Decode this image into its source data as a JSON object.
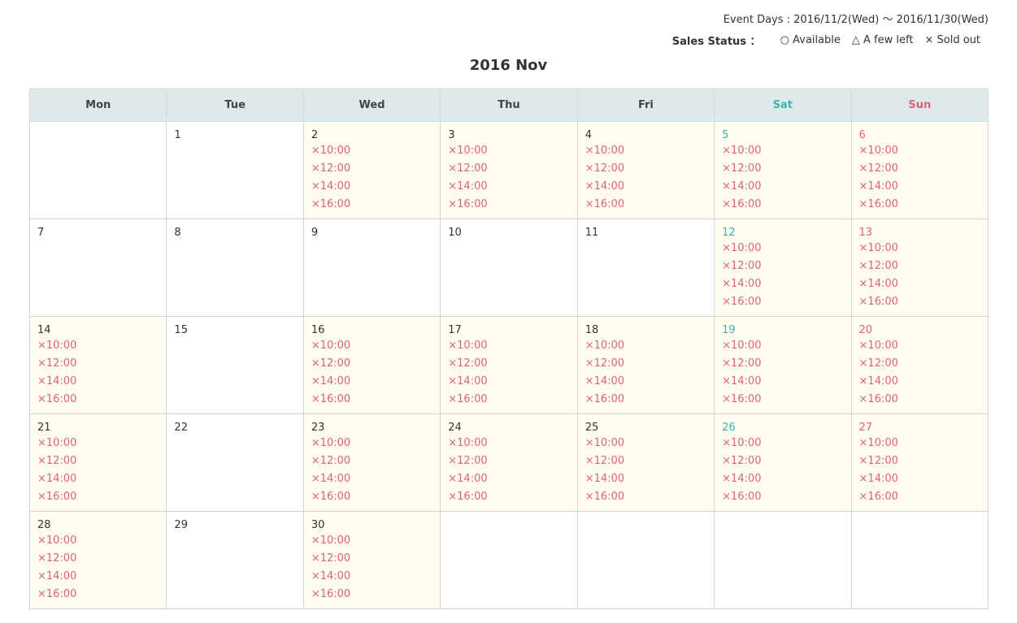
{
  "header": {
    "event_days": "Event Days : 2016/11/2(Wed) ～ 2016/11/30(Wed)",
    "sales_status_label": "Sales Status ：",
    "legend": [
      {
        "symbol": "○",
        "label": "Available",
        "icon": "circle-icon"
      },
      {
        "symbol": "△",
        "label": "A few left",
        "icon": "triangle-icon"
      },
      {
        "symbol": "×",
        "label": "Sold out",
        "icon": "cross-icon"
      }
    ]
  },
  "calendar": {
    "title": "2016 Nov",
    "weekdays": [
      "Mon",
      "Tue",
      "Wed",
      "Thu",
      "Fri",
      "Sat",
      "Sun"
    ],
    "colors": {
      "sat": "#3fb2b0",
      "sun": "#e0607e",
      "sold_out": "#e0607e",
      "event_bg": "#fffcf0",
      "header_bg": "#deeaea"
    },
    "weeks": [
      [
        {
          "day": "",
          "slots": []
        },
        {
          "day": "1",
          "slots": []
        },
        {
          "day": "2",
          "slots": [
            "×10:00",
            "×12:00",
            "×14:00",
            "×16:00"
          ]
        },
        {
          "day": "3",
          "slots": [
            "×10:00",
            "×12:00",
            "×14:00",
            "×16:00"
          ]
        },
        {
          "day": "4",
          "slots": [
            "×10:00",
            "×12:00",
            "×14:00",
            "×16:00"
          ]
        },
        {
          "day": "5",
          "slots": [
            "×10:00",
            "×12:00",
            "×14:00",
            "×16:00"
          ]
        },
        {
          "day": "6",
          "slots": [
            "×10:00",
            "×12:00",
            "×14:00",
            "×16:00"
          ]
        }
      ],
      [
        {
          "day": "7",
          "slots": []
        },
        {
          "day": "8",
          "slots": []
        },
        {
          "day": "9",
          "slots": []
        },
        {
          "day": "10",
          "slots": []
        },
        {
          "day": "11",
          "slots": []
        },
        {
          "day": "12",
          "slots": [
            "×10:00",
            "×12:00",
            "×14:00",
            "×16:00"
          ]
        },
        {
          "day": "13",
          "slots": [
            "×10:00",
            "×12:00",
            "×14:00",
            "×16:00"
          ]
        }
      ],
      [
        {
          "day": "14",
          "slots": [
            "×10:00",
            "×12:00",
            "×14:00",
            "×16:00"
          ]
        },
        {
          "day": "15",
          "slots": []
        },
        {
          "day": "16",
          "slots": [
            "×10:00",
            "×12:00",
            "×14:00",
            "×16:00"
          ]
        },
        {
          "day": "17",
          "slots": [
            "×10:00",
            "×12:00",
            "×14:00",
            "×16:00"
          ]
        },
        {
          "day": "18",
          "slots": [
            "×10:00",
            "×12:00",
            "×14:00",
            "×16:00"
          ]
        },
        {
          "day": "19",
          "slots": [
            "×10:00",
            "×12:00",
            "×14:00",
            "×16:00"
          ]
        },
        {
          "day": "20",
          "slots": [
            "×10:00",
            "×12:00",
            "×14:00",
            "×16:00"
          ]
        }
      ],
      [
        {
          "day": "21",
          "slots": [
            "×10:00",
            "×12:00",
            "×14:00",
            "×16:00"
          ]
        },
        {
          "day": "22",
          "slots": []
        },
        {
          "day": "23",
          "slots": [
            "×10:00",
            "×12:00",
            "×14:00",
            "×16:00"
          ]
        },
        {
          "day": "24",
          "slots": [
            "×10:00",
            "×12:00",
            "×14:00",
            "×16:00"
          ]
        },
        {
          "day": "25",
          "slots": [
            "×10:00",
            "×12:00",
            "×14:00",
            "×16:00"
          ]
        },
        {
          "day": "26",
          "slots": [
            "×10:00",
            "×12:00",
            "×14:00",
            "×16:00"
          ]
        },
        {
          "day": "27",
          "slots": [
            "×10:00",
            "×12:00",
            "×14:00",
            "×16:00"
          ]
        }
      ],
      [
        {
          "day": "28",
          "slots": [
            "×10:00",
            "×12:00",
            "×14:00",
            "×16:00"
          ]
        },
        {
          "day": "29",
          "slots": []
        },
        {
          "day": "30",
          "slots": [
            "×10:00",
            "×12:00",
            "×14:00",
            "×16:00"
          ]
        },
        {
          "day": "",
          "slots": []
        },
        {
          "day": "",
          "slots": []
        },
        {
          "day": "",
          "slots": []
        },
        {
          "day": "",
          "slots": []
        }
      ]
    ]
  }
}
